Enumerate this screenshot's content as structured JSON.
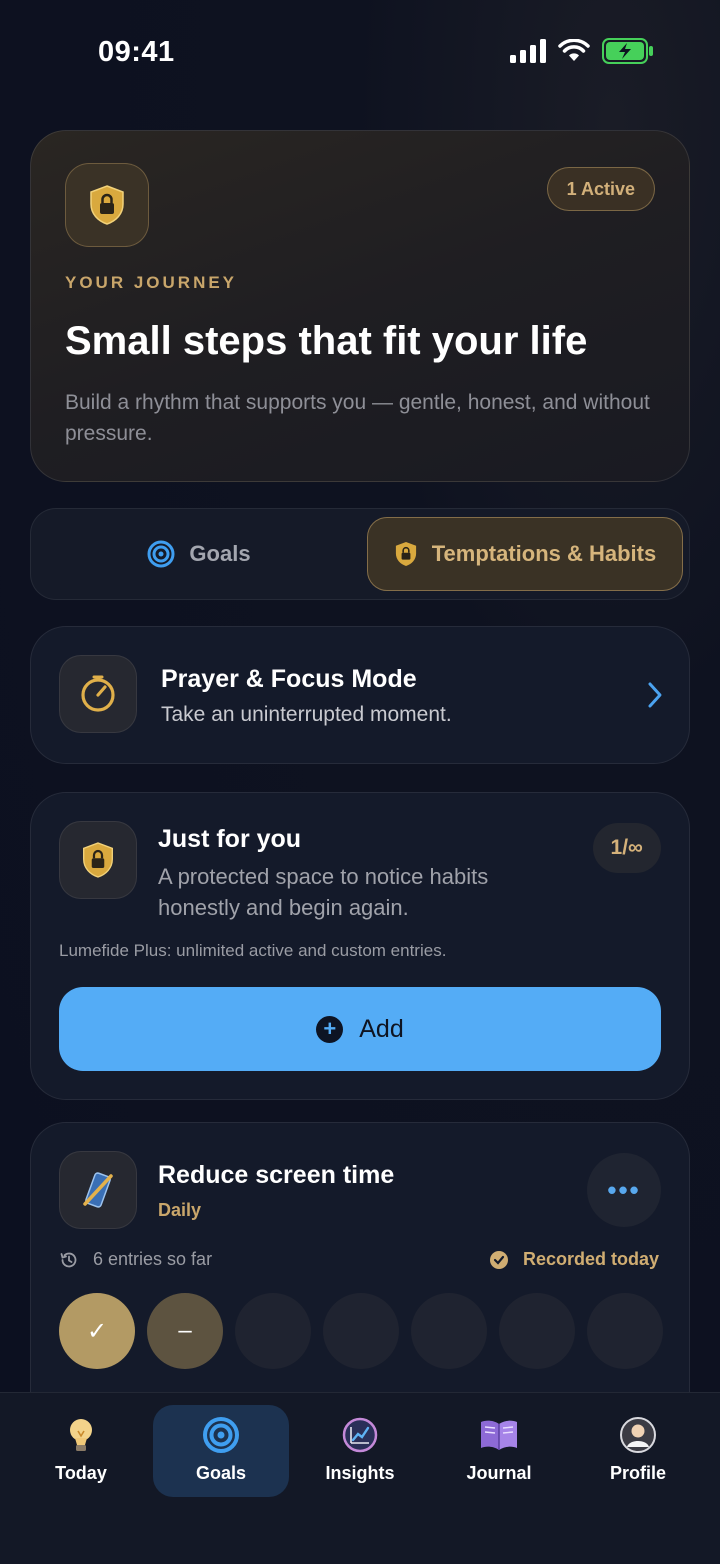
{
  "status_bar": {
    "time": "09:41"
  },
  "hero": {
    "badge": "1 Active",
    "eyebrow": "YOUR JOURNEY",
    "title": "Small steps that fit your life",
    "subtitle": "Build a rhythm that supports you — gentle, honest, and without pressure."
  },
  "segments": [
    {
      "label": "Goals",
      "icon": "target-icon",
      "selected": false
    },
    {
      "label": "Temptations & Habits",
      "icon": "shield-lock-icon",
      "selected": true
    }
  ],
  "focus_mode": {
    "title": "Prayer & Focus Mode",
    "subtitle": "Take an uninterrupted moment."
  },
  "just_for_you": {
    "title": "Just for you",
    "subtitle": "A protected space to notice habits honestly and begin again.",
    "count": "1/∞",
    "note": "Lumefide Plus: unlimited active and custom entries.",
    "add_label": "Add"
  },
  "habit": {
    "title": "Reduce screen time",
    "frequency": "Daily",
    "entries": "6 entries so far",
    "recorded": "Recorded today",
    "days": [
      "done",
      "skip",
      "empty",
      "empty",
      "empty",
      "empty",
      "empty"
    ],
    "done_symbol": "✓",
    "skip_symbol": "–"
  },
  "tabs": [
    {
      "label": "Today",
      "icon": "lightbulb-icon"
    },
    {
      "label": "Goals",
      "icon": "target-icon",
      "active": true
    },
    {
      "label": "Insights",
      "icon": "chart-icon"
    },
    {
      "label": "Journal",
      "icon": "book-icon"
    },
    {
      "label": "Profile",
      "icon": "profile-icon"
    }
  ],
  "colors": {
    "accent_gold": "#c9a66b",
    "accent_blue": "#54acf6",
    "background": "#0c1020"
  }
}
